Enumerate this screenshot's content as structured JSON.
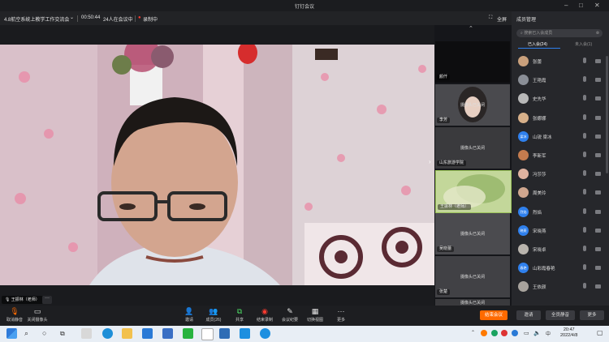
{
  "window": {
    "title": "钉钉会议"
  },
  "info": {
    "meeting_name": "4.8航空系统上教学工作交流会",
    "duration": "00:50:44",
    "attendee_status": "24人在会议中",
    "recording": "录制中",
    "fullscreen": "全屏"
  },
  "main_video": {
    "speaker_label": "王振林（老师）"
  },
  "thumbnails": [
    {
      "name": "颜仟",
      "status": ""
    },
    {
      "name": "李芳",
      "status": "摄像头已关闭"
    },
    {
      "name": "山东旅游学院",
      "status": "摄像头已关闭"
    },
    {
      "name": "王振林（老师）",
      "status": ""
    },
    {
      "name": "吴晓蕾",
      "status": "摄像头已关闭"
    },
    {
      "name": "张楚",
      "status": "摄像头已关闭"
    },
    {
      "name": "",
      "status": "摄像头已关闭"
    }
  ],
  "panel": {
    "title": "成员管理",
    "search_placeholder": "搜索已入会成员",
    "tab_joined": "已入会(24)",
    "tab_not_joined": "未入会(1)",
    "members": [
      {
        "name": "张蕾",
        "avatar_color": "#c9a07c",
        "avatar_text": ""
      },
      {
        "name": "王艳霞",
        "avatar_color": "#8a8e96",
        "avatar_text": ""
      },
      {
        "name": "史先华",
        "avatar_color": "#b8b8b8",
        "avatar_text": ""
      },
      {
        "name": "张娜娜",
        "avatar_color": "#d7b08a",
        "avatar_text": ""
      },
      {
        "name": "山锐 梁冰",
        "avatar_color": "#2f80ed",
        "avatar_text": "梁冰"
      },
      {
        "name": "李新军",
        "avatar_color": "#c47b4e",
        "avatar_text": ""
      },
      {
        "name": "冯莎莎",
        "avatar_color": "#e0b3a0",
        "avatar_text": ""
      },
      {
        "name": "周美玲",
        "avatar_color": "#cfa68e",
        "avatar_text": ""
      },
      {
        "name": "烈焰",
        "avatar_color": "#2f80ed",
        "avatar_text": "烈焰"
      },
      {
        "name": "宋晓燕",
        "avatar_color": "#2f80ed",
        "avatar_text": "晓燕"
      },
      {
        "name": "宋晓卓",
        "avatar_color": "#b9b4ad",
        "avatar_text": ""
      },
      {
        "name": "山彩霞春艳",
        "avatar_color": "#2f80ed",
        "avatar_text": "春艳"
      },
      {
        "name": "王依颜",
        "avatar_color": "#a8a39d",
        "avatar_text": ""
      }
    ]
  },
  "controls": {
    "unmute": "取消静音",
    "camera_off": "关闭摄像头",
    "invite": "邀请",
    "members": "成员(26)",
    "share": "共享",
    "end_recording": "结束录制",
    "minutes": "会议纪要",
    "switch_view": "切换视图",
    "more": "更多",
    "end_meeting": "结束会议",
    "invite_btn": "邀请",
    "mute_all": "全员静音",
    "more_btn": "更多"
  },
  "taskbar": {
    "time": "20:47",
    "date": "2022/4/8",
    "lang": "中"
  },
  "colors": {
    "accent": "#ff6a00",
    "blue": "#2f80ed",
    "record": "#ff3b30"
  }
}
